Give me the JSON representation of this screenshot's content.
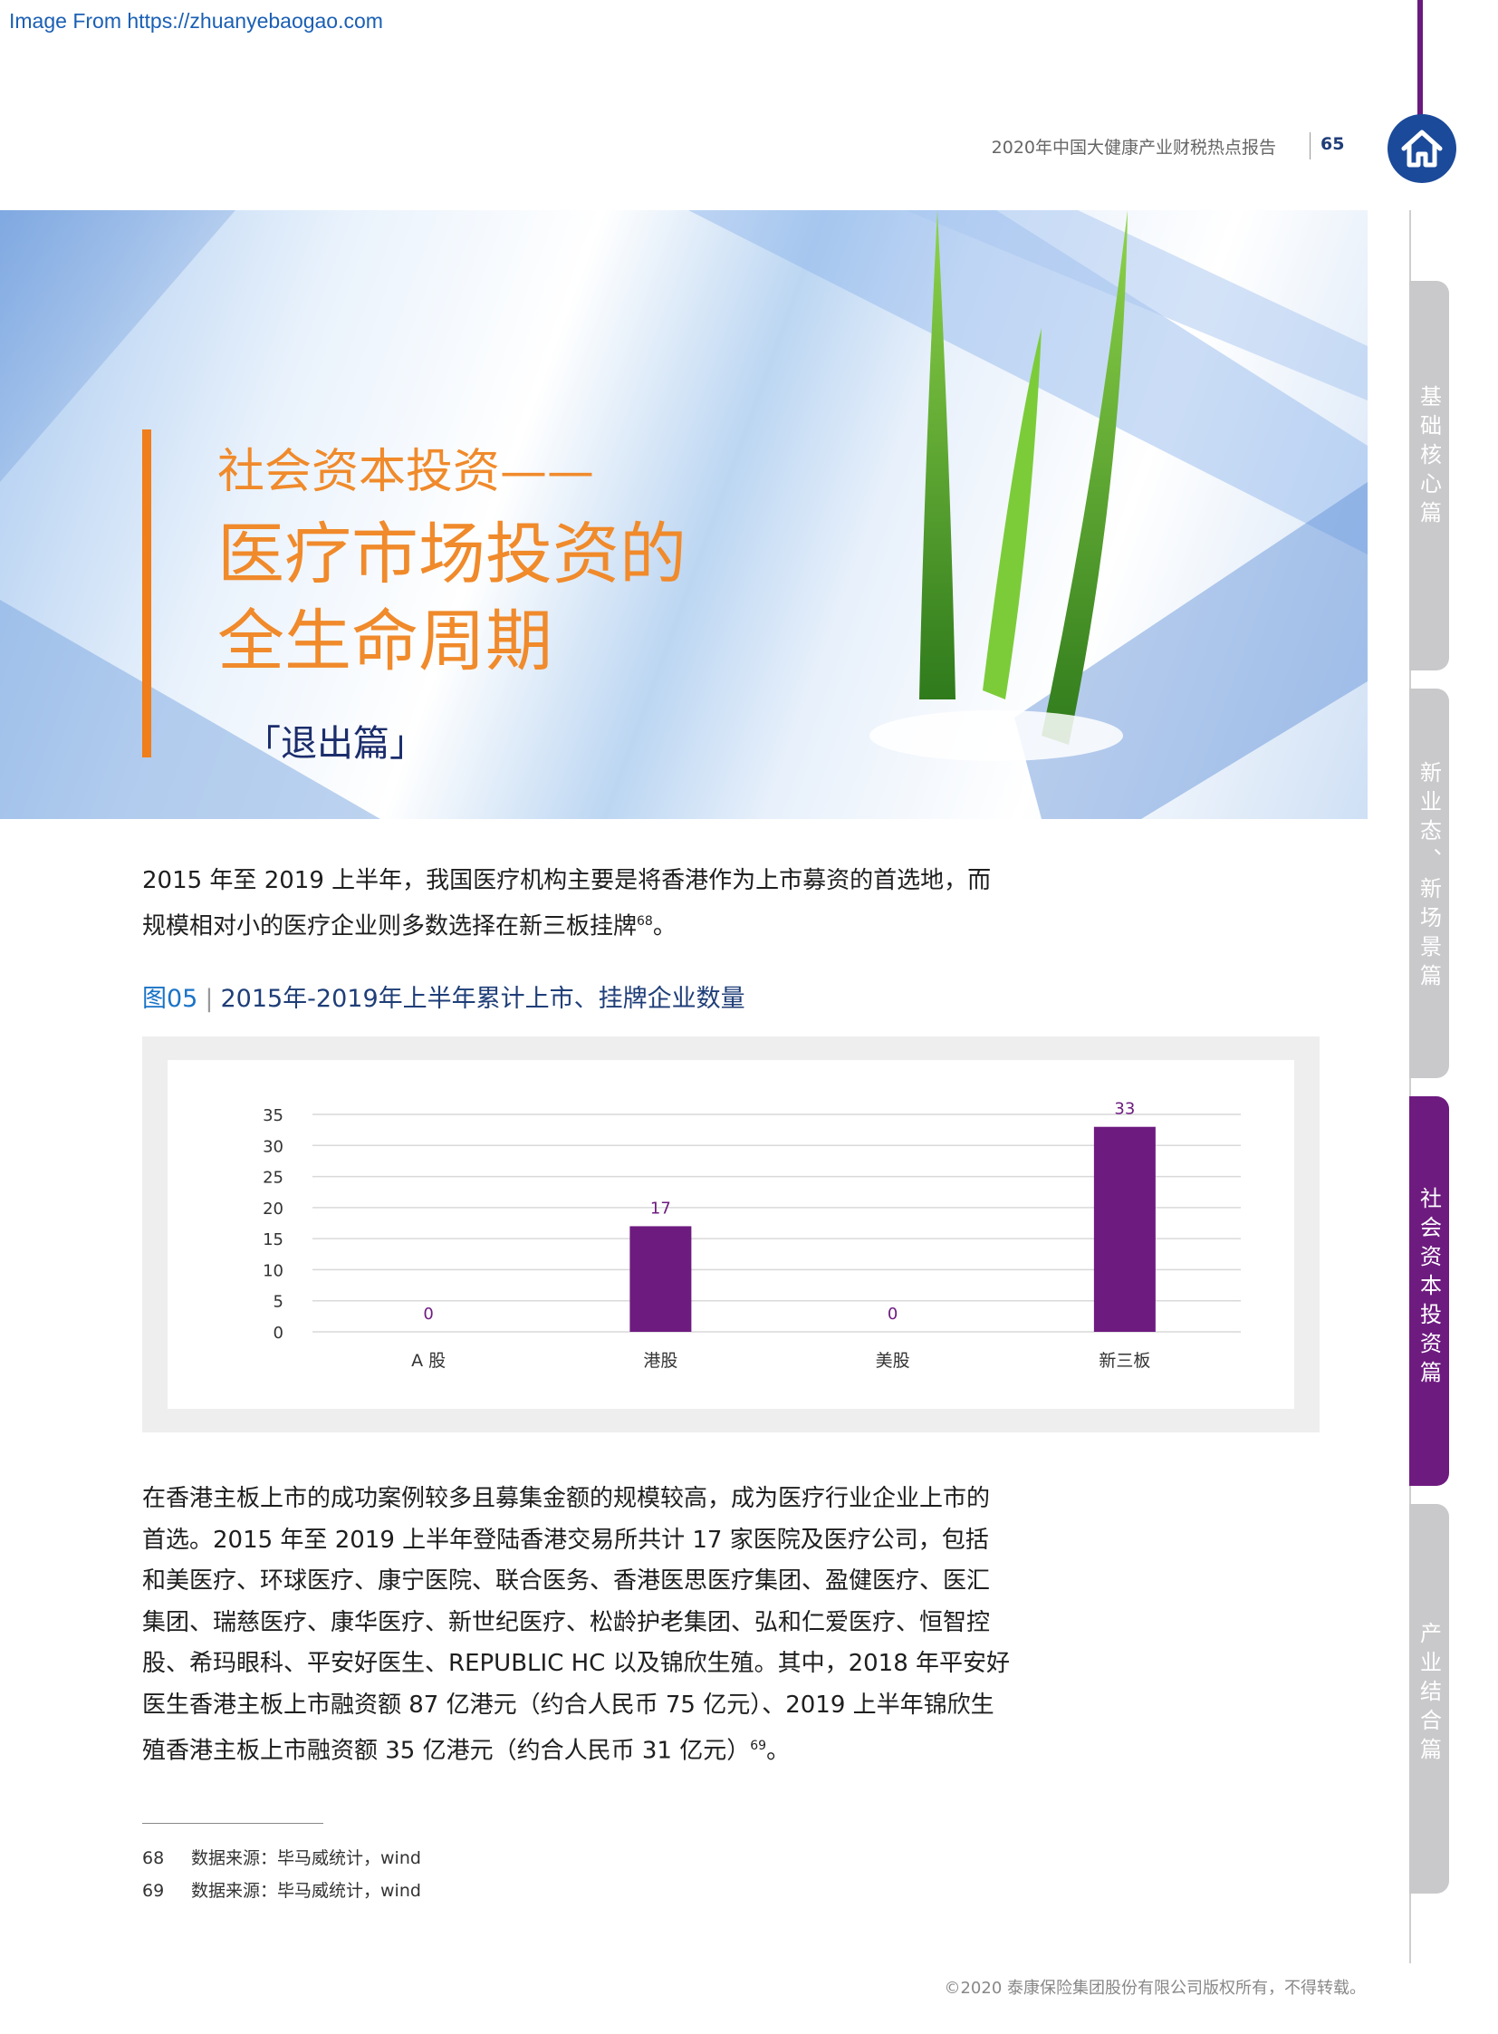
{
  "watermark": "Image From https://zhuanyebaogao.com",
  "header": {
    "report_title": "2020年中国大健康产业财税热点报告",
    "page_number": "65"
  },
  "side_tabs": [
    {
      "label": "基础核心篇",
      "active": false
    },
    {
      "label": "新业态、新场景篇",
      "active": false
    },
    {
      "label": "社会资本投资篇",
      "active": true
    },
    {
      "label": "产业结合篇",
      "active": false
    }
  ],
  "hero": {
    "subtitle": "社会资本投资——",
    "title_line1": "医疗市场投资的",
    "title_line2": "全生命周期",
    "tag": "「退出篇」"
  },
  "intro": {
    "text": "2015 年至 2019 上半年，我国医疗机构主要是将香港作为上市募资的首选地，而规模相对小的医疗企业则多数选择在新三板挂牌",
    "footnote_ref": "68",
    "end": "。"
  },
  "figure": {
    "number": "图05",
    "separator": "|",
    "title": "2015年-2019年上半年累计上市、挂牌企业数量"
  },
  "chart_data": {
    "type": "bar",
    "categories": [
      "A 股",
      "港股",
      "美股",
      "新三板"
    ],
    "values": [
      0,
      17,
      0,
      33
    ],
    "ylim": [
      0,
      35
    ],
    "yticks": [
      0,
      5,
      10,
      15,
      20,
      25,
      30,
      35
    ],
    "grid": true,
    "bar_color": "#6e1b80",
    "label_color": "#6e1b80"
  },
  "body": {
    "text": "在香港主板上市的成功案例较多且募集金额的规模较高，成为医疗行业企业上市的首选。2015 年至 2019 上半年登陆香港交易所共计 17 家医院及医疗公司，包括和美医疗、环球医疗、康宁医院、联合医务、香港医思医疗集团、盈健医疗、医汇集团、瑞慈医疗、康华医疗、新世纪医疗、松龄护老集团、弘和仁爱医疗、恒智控股、希玛眼科、平安好医生、REPUBLIC HC 以及锦欣生殖。其中，2018 年平安好医生香港主板上市融资额 87 亿港元（约合人民币 75 亿元）、2019 上半年锦欣生殖香港主板上市融资额 35 亿港元（约合人民币 31 亿元）",
    "footnote_ref": "69",
    "end": "。"
  },
  "footnotes": [
    {
      "num": "68",
      "text": "数据来源：毕马威统计，wind"
    },
    {
      "num": "69",
      "text": "数据来源：毕马威统计，wind"
    }
  ],
  "copyright": "©2020 泰康保险集团股份有限公司版权所有，不得转载。",
  "colors": {
    "accent_purple": "#6e1b80",
    "accent_orange": "#f08a2b",
    "navy": "#1f3e78"
  }
}
